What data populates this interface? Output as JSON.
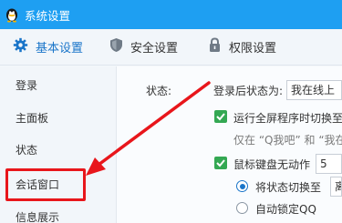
{
  "window": {
    "title": "系统设置",
    "accent_color": "#1e9ff2"
  },
  "tabs": [
    {
      "label": "基本设置",
      "icon": "gear-icon",
      "active": true
    },
    {
      "label": "安全设置",
      "icon": "shield-icon",
      "active": false
    },
    {
      "label": "权限设置",
      "icon": "lock-icon",
      "active": false
    }
  ],
  "sidebar": {
    "items": [
      {
        "label": "登录"
      },
      {
        "label": "主面板"
      },
      {
        "label": "状态"
      },
      {
        "label": "会话窗口",
        "highlighted": true
      },
      {
        "label": "信息展示"
      }
    ]
  },
  "status_panel": {
    "section_label": "状态:",
    "after_login_label": "登录后状态为:",
    "after_login_value": "我在线上",
    "fullscreen_switch_label": "运行全屏程序时切换至",
    "fullscreen_hint": "仅在 “Q我吧” 和 “我在",
    "idle_label": "鼠标键盘无动作",
    "idle_minutes": "5",
    "switch_state_label": "将状态切换至",
    "switch_state_value": "离",
    "auto_lock_label": "自动锁定QQ"
  },
  "annotation": {
    "highlight_color": "#e8161b"
  }
}
